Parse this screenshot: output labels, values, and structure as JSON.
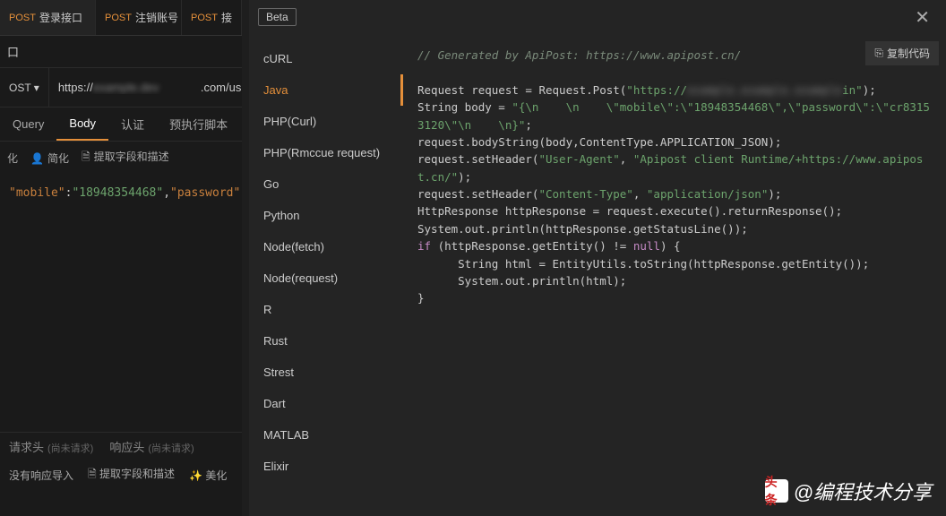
{
  "tabs": [
    {
      "method": "POST",
      "label": "登录接口",
      "modified": true
    },
    {
      "method": "POST",
      "label": "注销账号",
      "modified": false
    },
    {
      "method": "POST",
      "label": "接",
      "modified": false
    }
  ],
  "row2_label": "口",
  "method_row": {
    "method": "OST ▾",
    "url_prefix": "https://",
    "url_blur": "example.dev",
    "url_suffix": ".com/us"
  },
  "req_tabs": [
    "Query",
    "Body",
    "认证",
    "预执行脚本"
  ],
  "req_tab_active": 1,
  "toolbar": {
    "item1": "化",
    "item2": "简化",
    "item3": "提取字段和描述",
    "icon2": "👤",
    "icon3": "🗎"
  },
  "body_json": {
    "k1": "mobile",
    "v1": "18948354468",
    "k2": "password",
    "v2": "cr83"
  },
  "bottom": {
    "tab1": "请求头",
    "hint1": "(尚未请求)",
    "tab2": "响应头",
    "hint2": "(尚未请求)",
    "tool1": "没有响应导入",
    "tool2": "提取字段和描述",
    "tool3": "美化",
    "icon2": "🗎",
    "icon3": "✨"
  },
  "modal": {
    "beta": "Beta",
    "copy": "复制代码",
    "langs": [
      "cURL",
      "Java",
      "PHP(Curl)",
      "PHP(Rmccue request)",
      "Go",
      "Python",
      "Node(fetch)",
      "Node(request)",
      "R",
      "Rust",
      "Strest",
      "Dart",
      "MATLAB",
      "Elixir"
    ],
    "lang_active": 1,
    "code": {
      "comment": "// Generated by ApiPost: https://www.apipost.cn/",
      "l1a": "Request request = Request.Post(",
      "l1b": "\"https://",
      "l1blur": "example.example.example",
      "l1c": "in\"",
      "l1d": ");",
      "l2a": "String body = ",
      "l2b": "\"{\\n    \\n    \\\"mobile\\\":\\\"18948354468\\\",\\\"password\\\":\\\"cr83153120\\\"\\n    \\n}\"",
      "l2c": ";",
      "l3": "request.bodyString(body,ContentType.APPLICATION_JSON);",
      "l4a": "request.setHeader(",
      "l4b": "\"User-Agent\"",
      "l4c": ", ",
      "l4d": "\"Apipost client Runtime/+https://www.apipost.cn/\"",
      "l4e": ");",
      "l5a": "request.setHeader(",
      "l5b": "\"Content-Type\"",
      "l5c": ", ",
      "l5d": "\"application/json\"",
      "l5e": ");",
      "l6": "HttpResponse httpResponse = request.execute().returnResponse();",
      "l7": "System.out.println(httpResponse.getStatusLine());",
      "l8a": "if",
      "l8b": " (httpResponse.getEntity() != ",
      "l8c": "null",
      "l8d": ") {",
      "l9": "      String html = EntityUtils.toString(httpResponse.getEntity());",
      "l10": "      System.out.println(html);",
      "l11": "}"
    }
  },
  "watermark": {
    "logo": "头条",
    "text": "@编程技术分享"
  }
}
